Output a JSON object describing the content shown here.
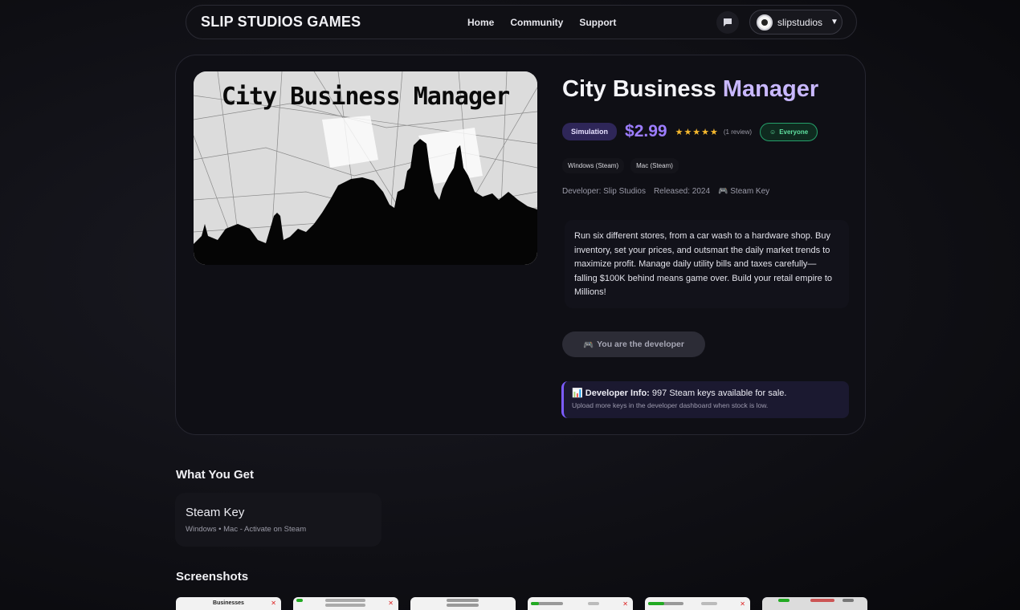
{
  "nav": {
    "brand": "SLIP STUDIOS GAMES",
    "links": [
      "Home",
      "Community",
      "Support"
    ],
    "username": "slipstudios"
  },
  "game": {
    "cover_title": "City Business Manager",
    "title_part1": "City Business",
    "title_part2": "Manager",
    "genre": "Simulation",
    "price": "$2.99",
    "stars": "★★★★★",
    "reviews": "(1 review)",
    "age_rating": "Everyone",
    "platforms": [
      "Windows (Steam)",
      "Mac (Steam)"
    ],
    "developer": "Developer: Slip Studios",
    "released": "Released: 2024",
    "key_type": "Steam Key",
    "description": "Run six different stores, from a car wash to a hardware shop. Buy inventory, set your prices, and outsmart the daily market trends to maximize profit. Manage daily utility bills and taxes carefully—falling $100K behind means game over. Build your retail empire to Millions!",
    "dev_button": "You are the developer",
    "dev_info_label": "Developer Info:",
    "dev_info_text": "997 Steam keys available for sale.",
    "dev_info_sub": "Upload more keys in the developer dashboard when stock is low."
  },
  "what_you_get": {
    "heading": "What You Get",
    "item_title": "Steam Key",
    "item_sub": "Windows • Mac - Activate on Steam"
  },
  "screenshots": {
    "heading": "Screenshots",
    "first_caption": "Businesses"
  },
  "colors": {
    "accent": "#9d7dff",
    "title_accent": "#c9b8ff",
    "rating_green": "#5fe0a0"
  }
}
